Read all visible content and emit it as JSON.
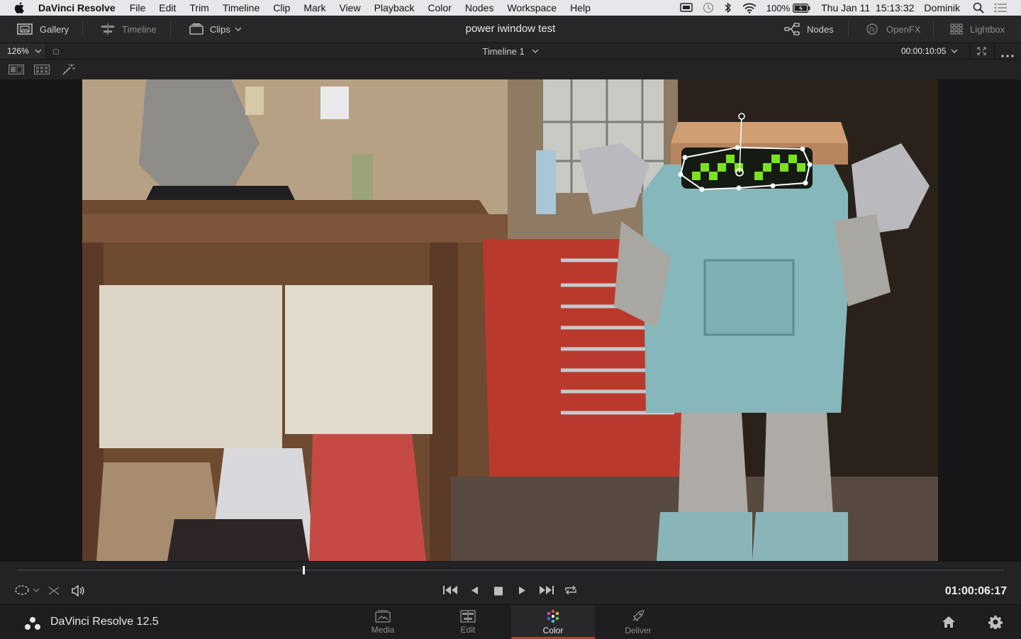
{
  "menubar": {
    "app_name": "DaVinci Resolve",
    "items": [
      "File",
      "Edit",
      "Trim",
      "Timeline",
      "Clip",
      "Mark",
      "View",
      "Playback",
      "Color",
      "Nodes",
      "Workspace",
      "Help"
    ],
    "battery": "100%",
    "datetime": "Thu Jan 11  15:13:32",
    "user": "Dominik"
  },
  "header": {
    "gallery": "Gallery",
    "timeline": "Timeline",
    "clips": "Clips",
    "project_title": "power iwindow test",
    "nodes": "Nodes",
    "openfx": "OpenFX",
    "lightbox": "Lightbox"
  },
  "viewer": {
    "zoom": "126%",
    "timeline_name": "Timeline 1",
    "source_timecode": "00:00:10:05"
  },
  "transport": {
    "timecode": "01:00:06:17",
    "scrub_position": 0.29
  },
  "footer": {
    "app_version": "DaVinci Resolve 12.5",
    "pages": [
      {
        "label": "Media",
        "active": false
      },
      {
        "label": "Edit",
        "active": false
      },
      {
        "label": "Color",
        "active": true
      },
      {
        "label": "Deliver",
        "active": false
      }
    ]
  },
  "colors": {
    "accent": "#d03030",
    "window_outline": "#ffffff",
    "robot_eyes": "#7be21f"
  }
}
